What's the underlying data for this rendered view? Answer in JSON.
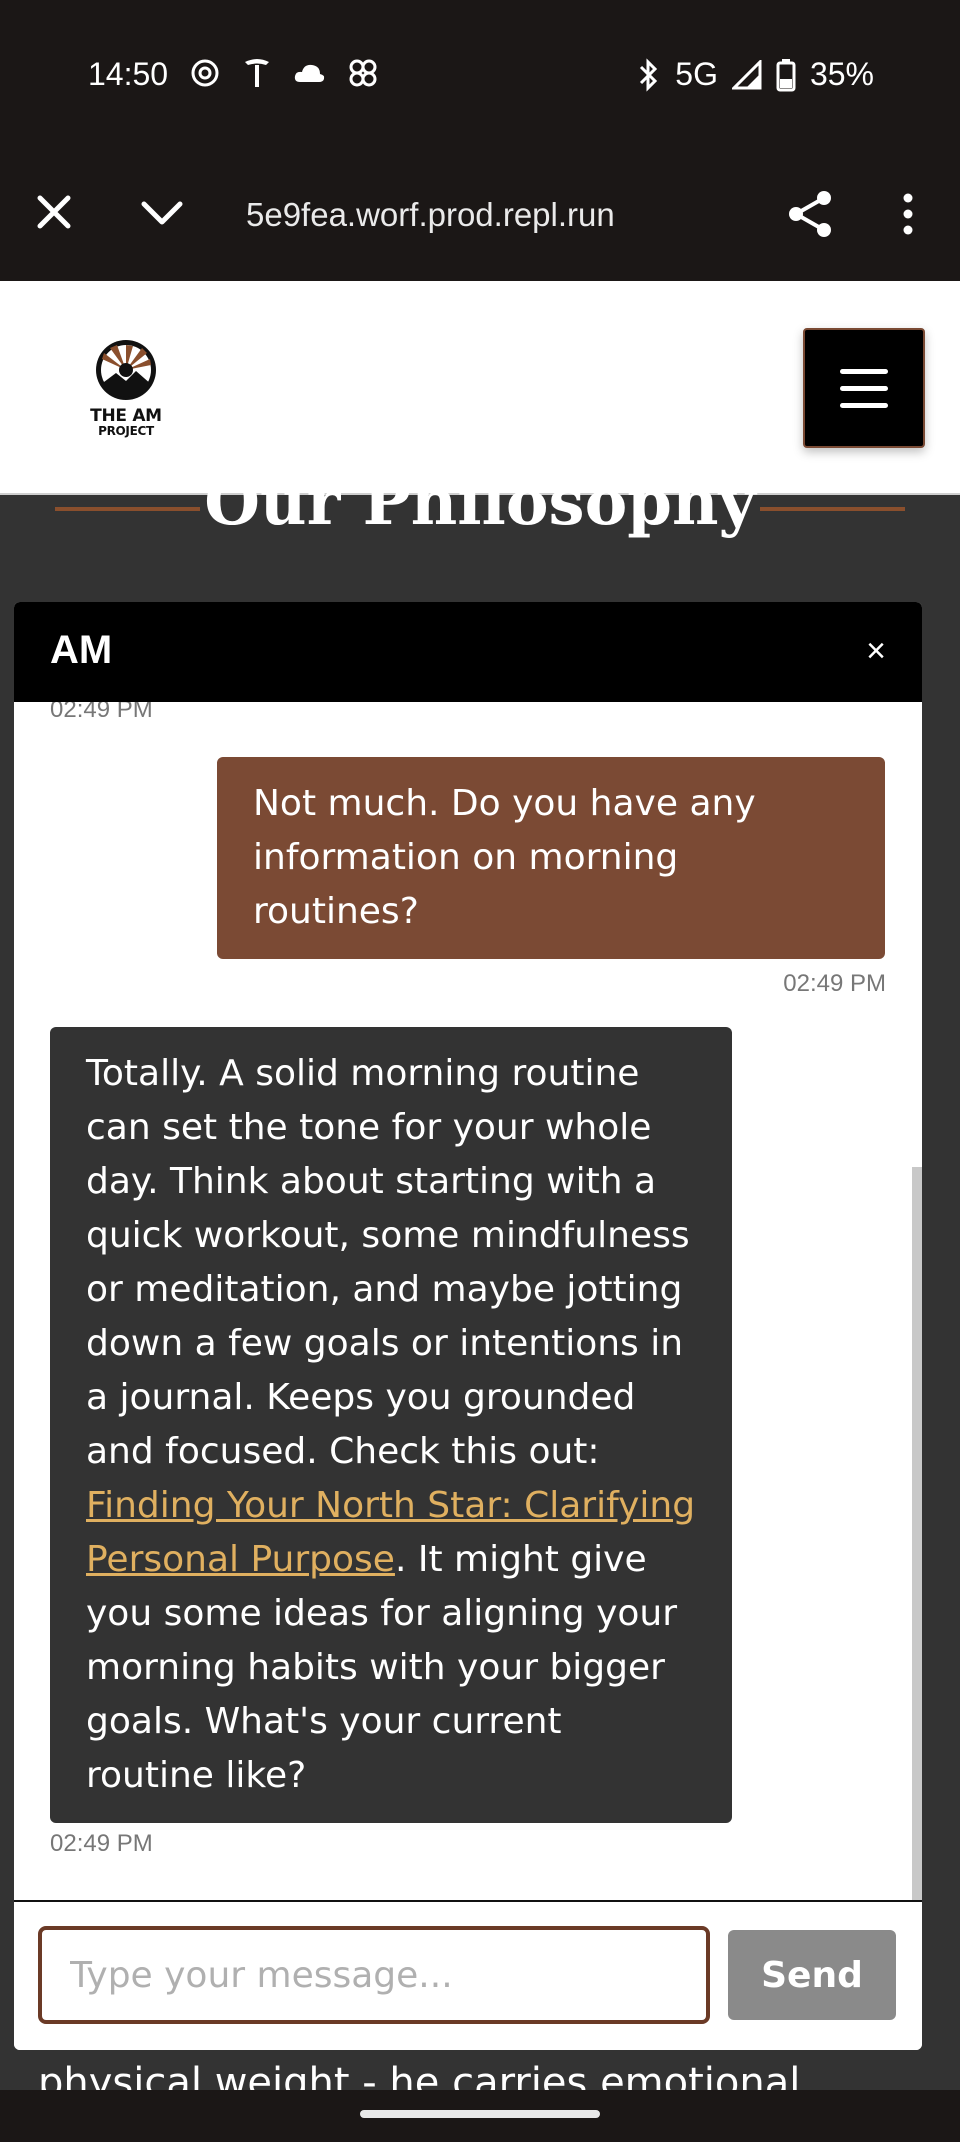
{
  "status_bar": {
    "time": "14:50",
    "network": "5G",
    "battery": "35%",
    "left_icons": [
      "openai-icon",
      "tesla-icon",
      "cloud-icon",
      "pinwheel-icon"
    ],
    "right_icons": [
      "bluetooth-icon",
      "signal-icon",
      "battery-icon"
    ]
  },
  "browser": {
    "url": "5e9fea.worf.prod.repl.run"
  },
  "site": {
    "logo_line1": "THE AM",
    "logo_line2": "PROJECT"
  },
  "background_page": {
    "section_title": "Our Philosophy",
    "partial_text": "physical weight - he carries emotional"
  },
  "chat": {
    "title": "AM",
    "close_label": "×",
    "messages": [
      {
        "sender": "bot",
        "time": "02:49 PM"
      },
      {
        "sender": "user",
        "text": "Not much. Do you have any information on morning routines?",
        "time": "02:49 PM"
      },
      {
        "sender": "bot",
        "text_before": "Totally. A solid morning routine can set the tone for your whole day. Think about starting with a quick workout, some mindfulness or meditation, and maybe jotting down a few goals or intentions in a journal. Keeps you grounded and focused. Check this out: ",
        "link_text": "Finding Your North Star: Clarifying Personal Purpose",
        "text_after": ". It might give you some ideas for aligning your morning habits with your bigger goals. What's your current routine like?",
        "time": "02:49 PM"
      }
    ],
    "input_placeholder": "Type your message...",
    "send_label": "Send"
  },
  "colors": {
    "user_bubble": "#7b4a34",
    "bot_bubble": "#333333",
    "link": "#e0b060",
    "accent": "#8a4f2d"
  }
}
